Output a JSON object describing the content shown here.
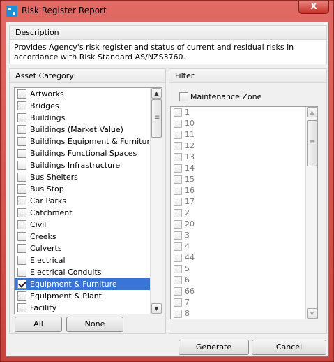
{
  "window": {
    "title": "Risk Register Report",
    "close_label": "X"
  },
  "description": {
    "header": "Description",
    "text": "Provides Agency's risk register and status of current and residual risks in accordance with Risk Standard AS/NZS3760."
  },
  "asset_category": {
    "header": "Asset Category",
    "items": [
      {
        "label": "Artworks",
        "checked": false
      },
      {
        "label": "Bridges",
        "checked": false
      },
      {
        "label": "Buildings",
        "checked": false
      },
      {
        "label": "Buildings (Market Value)",
        "checked": false
      },
      {
        "label": "Buildings Equipment & Furniture",
        "checked": false
      },
      {
        "label": "Buildings Functional Spaces",
        "checked": false
      },
      {
        "label": "Buildings Infrastructure",
        "checked": false
      },
      {
        "label": "Bus Shelters",
        "checked": false
      },
      {
        "label": "Bus Stop",
        "checked": false
      },
      {
        "label": "Car Parks",
        "checked": false
      },
      {
        "label": "Catchment",
        "checked": false
      },
      {
        "label": "Civil",
        "checked": false
      },
      {
        "label": "Creeks",
        "checked": false
      },
      {
        "label": "Culverts",
        "checked": false
      },
      {
        "label": "Electrical",
        "checked": false
      },
      {
        "label": "Electrical Conduits",
        "checked": false
      },
      {
        "label": "Equipment & Furniture",
        "checked": true,
        "selected": true
      },
      {
        "label": "Equipment & Plant",
        "checked": false
      },
      {
        "label": "Facility",
        "checked": false
      }
    ],
    "all_label": "All",
    "none_label": "None"
  },
  "filter": {
    "header": "Filter",
    "maintenance_zone_label": "Maintenance Zone",
    "items": [
      "1",
      "10",
      "11",
      "12",
      "13",
      "14",
      "15",
      "16",
      "17",
      "2",
      "20",
      "3",
      "4",
      "44",
      "5",
      "6",
      "66",
      "7",
      "8"
    ]
  },
  "footer": {
    "generate_label": "Generate",
    "cancel_label": "Cancel"
  }
}
